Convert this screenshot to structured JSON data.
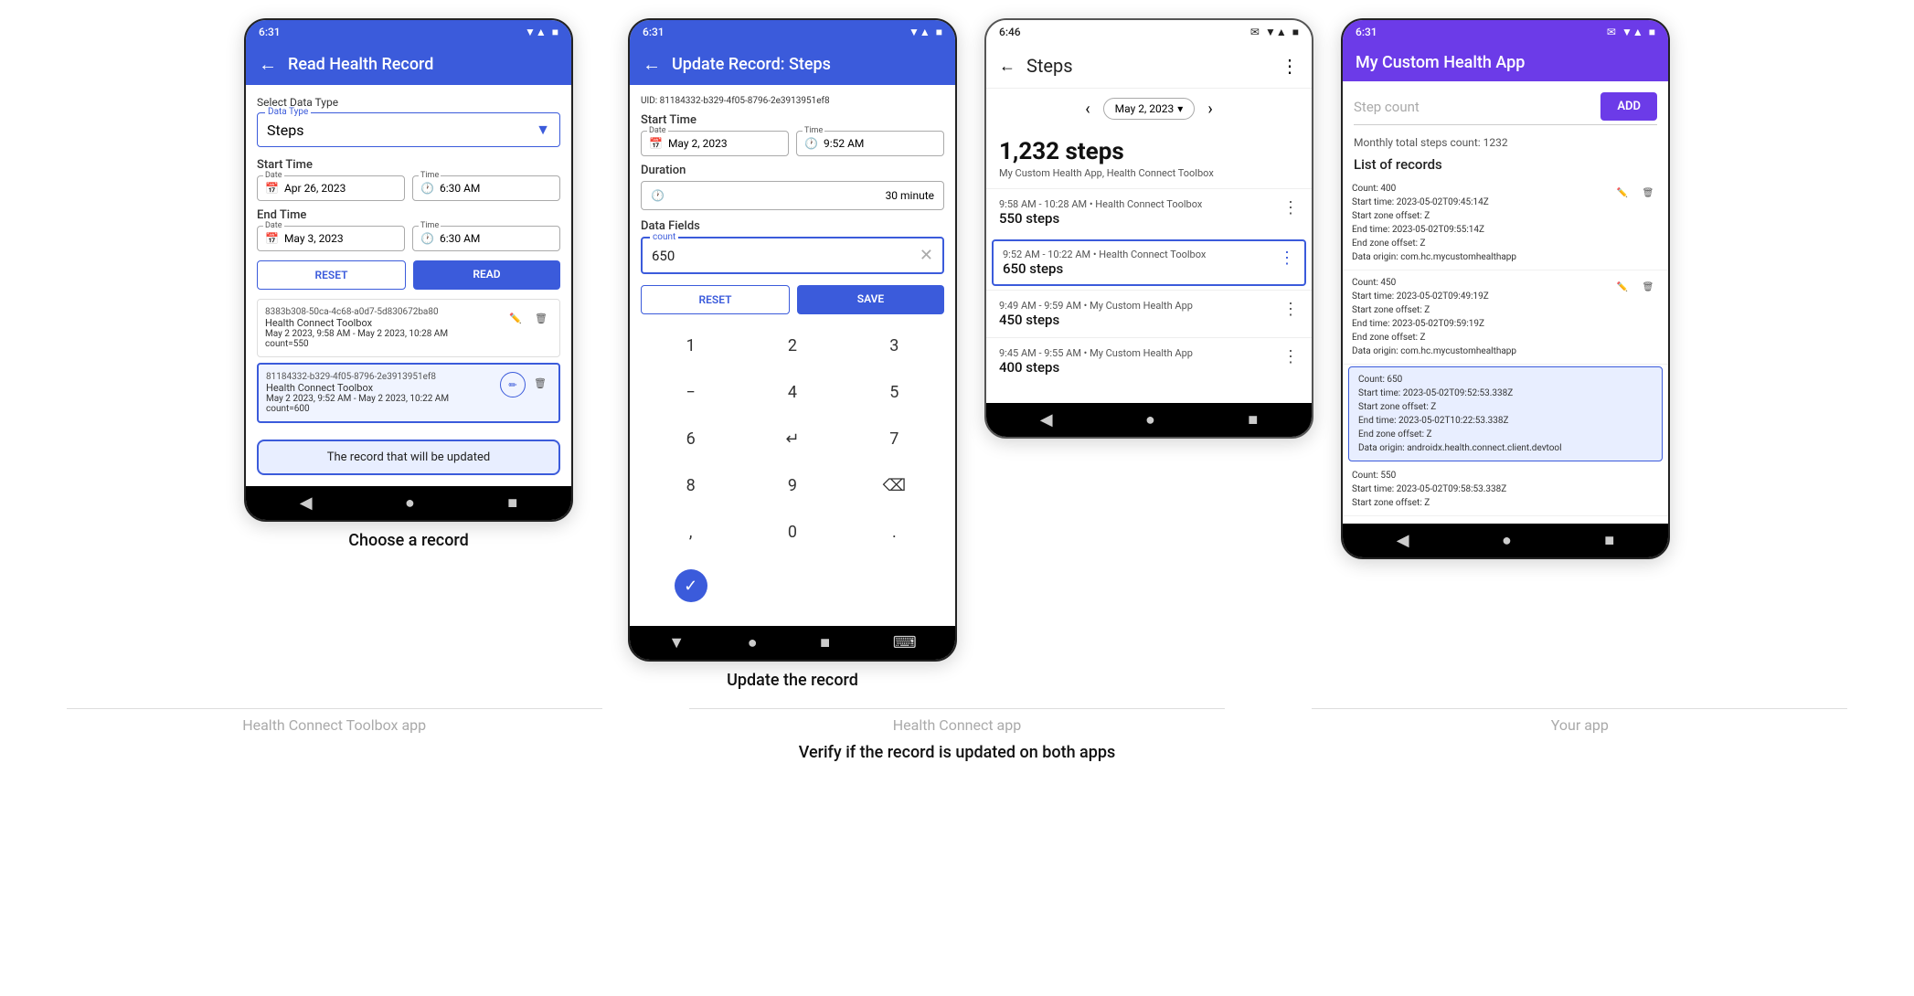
{
  "phones": [
    {
      "id": "phone1",
      "status_bar": {
        "time": "6:31",
        "icons": "▼ ▲ ■"
      },
      "app_bar_title": "Read Health Record",
      "data_type_label": "Data Type",
      "data_type_value": "Steps",
      "select_data_type": "Select Data Type",
      "start_time_label": "Start Time",
      "start_date": "Apr 26, 2023",
      "start_time": "6:30 AM",
      "end_time_label": "End Time",
      "end_date": "May 3, 2023",
      "end_time": "6:30 AM",
      "date_label": "Date",
      "time_label": "Time",
      "btn_reset": "RESET",
      "btn_read": "READ",
      "records": [
        {
          "id_text": "8383b308-50ca-4c68-a0d7-5d830672ba80",
          "source": "Health Connect Toolbox",
          "date_range": "May 2 2023, 9:58 AM - May 2 2023, 10:28 AM",
          "count": "count=550",
          "highlighted": false
        },
        {
          "id_text": "81184332-b329-4f05-8796-2e3913951ef8",
          "source": "Health Connect Toolbox",
          "date_range": "May 2 2023, 9:52 AM - May 2 2023, 10:22 AM",
          "count": "count=600",
          "highlighted": true
        }
      ],
      "tooltip": "The record that will be updated",
      "nav": [
        "◀",
        "●",
        "■"
      ]
    },
    {
      "id": "phone2",
      "status_bar": {
        "time": "6:31",
        "icons": "▼ ▲ ■"
      },
      "app_bar_title": "Update Record: Steps",
      "uid_label": "UID: 81184332-b329-4f05-8796-2e3913951ef8",
      "start_time_label": "Start Time",
      "start_date": "May 2, 2023",
      "start_time": "9:52 AM",
      "duration_label": "Duration",
      "duration_value": "30 minute",
      "data_fields_label": "Data Fields",
      "count_label": "count",
      "count_value": "650",
      "btn_reset": "RESET",
      "btn_save": "SAVE",
      "numpad": [
        "1",
        "2",
        "3",
        "−",
        "4",
        "5",
        "6",
        "↵",
        "7",
        "8",
        "9",
        "⌫",
        ",",
        "0",
        ".",
        "✓"
      ],
      "nav": [
        "▼",
        "●",
        "■",
        "⌨"
      ]
    },
    {
      "id": "phone3",
      "status_bar": {
        "time": "6:46",
        "icons": "▼ ▲ ■"
      },
      "title": "Steps",
      "date_chip": "May 2, 2023",
      "total_steps": "1,232 steps",
      "total_source": "My Custom Health App, Health Connect Toolbox",
      "records": [
        {
          "time_range": "9:58 AM - 10:28 AM • Health Connect Toolbox",
          "steps": "550 steps",
          "selected": false
        },
        {
          "time_range": "9:52 AM - 10:22 AM • Health Connect Toolbox",
          "steps": "650 steps",
          "selected": true
        },
        {
          "time_range": "9:49 AM - 9:59 AM • My Custom Health App",
          "steps": "450 steps",
          "selected": false
        },
        {
          "time_range": "9:45 AM - 9:55 AM • My Custom Health App",
          "steps": "400 steps",
          "selected": false
        }
      ],
      "nav": [
        "◀",
        "●",
        "■"
      ]
    },
    {
      "id": "phone4",
      "status_bar": {
        "time": "6:31",
        "icons": "▼ ▲ ■"
      },
      "app_bar_title": "My Custom Health App",
      "step_count_placeholder": "Step count",
      "btn_add": "ADD",
      "monthly_text": "Monthly total steps count: 1232",
      "list_title": "List of records",
      "records": [
        {
          "count": "Count: 400",
          "start_time": "Start time: 2023-05-02T09:45:14Z",
          "start_zone": "Start zone offset: Z",
          "end_time": "End time: 2023-05-02T09:55:14Z",
          "end_zone": "End zone offset: Z",
          "data_origin": "Data origin: com.hc.mycustomhealthapp",
          "highlighted": false
        },
        {
          "count": "Count: 450",
          "start_time": "Start time: 2023-05-02T09:49:19Z",
          "start_zone": "Start zone offset: Z",
          "end_time": "End time: 2023-05-02T09:59:19Z",
          "end_zone": "End zone offset: Z",
          "data_origin": "Data origin: com.hc.mycustomhealthapp",
          "highlighted": false
        },
        {
          "count": "Count: 650",
          "start_time": "Start time: 2023-05-02T09:52:53.338Z",
          "start_zone": "Start zone offset: Z",
          "end_time": "End time: 2023-05-02T10:22:53.338Z",
          "end_zone": "End zone offset: Z",
          "data_origin": "Data origin: androidx.health.connect.client.devtool",
          "highlighted": true
        },
        {
          "count": "Count: 550",
          "start_time": "Start time: 2023-05-02T09:58:53.338Z",
          "start_zone": "Start zone offset: Z",
          "highlighted": false
        }
      ],
      "nav": [
        "◀",
        "●",
        "■"
      ]
    }
  ],
  "captions": [
    "Choose a record",
    "Update the record",
    "Verify if the record is updated on both apps"
  ],
  "bottom_labels": [
    "Health Connect Toolbox  app",
    "Health Connect app",
    "Your app"
  ]
}
